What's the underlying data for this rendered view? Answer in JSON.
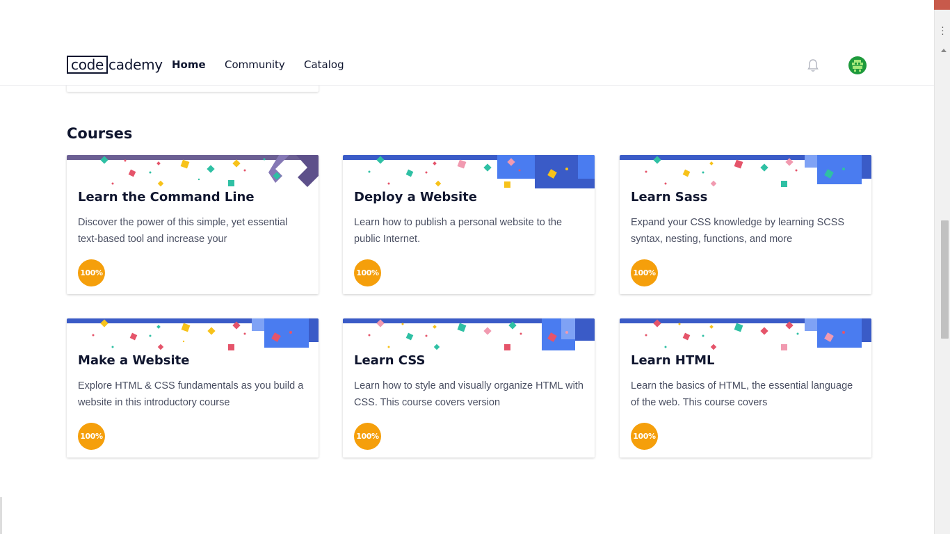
{
  "header": {
    "logo": {
      "boxed": "code",
      "rest": "cademy"
    },
    "nav": [
      {
        "label": "Home",
        "active": true
      },
      {
        "label": "Community",
        "active": false
      },
      {
        "label": "Catalog",
        "active": false
      }
    ],
    "icons": {
      "notifications": "bell-icon",
      "profile": "avatar"
    }
  },
  "courses": {
    "heading": "Courses",
    "items": [
      {
        "title": "Learn the Command Line",
        "description": "Discover the power of this simple, yet essential text-based tool and increase your",
        "progress": "100%",
        "theme": "purple"
      },
      {
        "title": "Deploy a Website",
        "description": "Learn how to publish a personal website to the public Internet.",
        "progress": "100%",
        "theme": "blue"
      },
      {
        "title": "Learn Sass",
        "description": "Expand your CSS knowledge by learning SCSS syntax, nesting, functions, and more",
        "progress": "100%",
        "theme": "blue"
      },
      {
        "title": "Make a Website",
        "description": "Explore HTML & CSS fundamentals as you build a website in this introductory course",
        "progress": "100%",
        "theme": "blue"
      },
      {
        "title": "Learn CSS",
        "description": "Learn how to style and visually organize HTML with CSS. This course covers version",
        "progress": "100%",
        "theme": "blue"
      },
      {
        "title": "Learn HTML",
        "description": "Learn the basics of HTML, the essential language of the web. This course covers",
        "progress": "100%",
        "theme": "blue"
      }
    ]
  },
  "colors": {
    "progress_badge": "#f59f0b",
    "banner_blue": "#3a5bc7",
    "banner_purple": "#6b5f93",
    "text_dark": "#10162f"
  }
}
